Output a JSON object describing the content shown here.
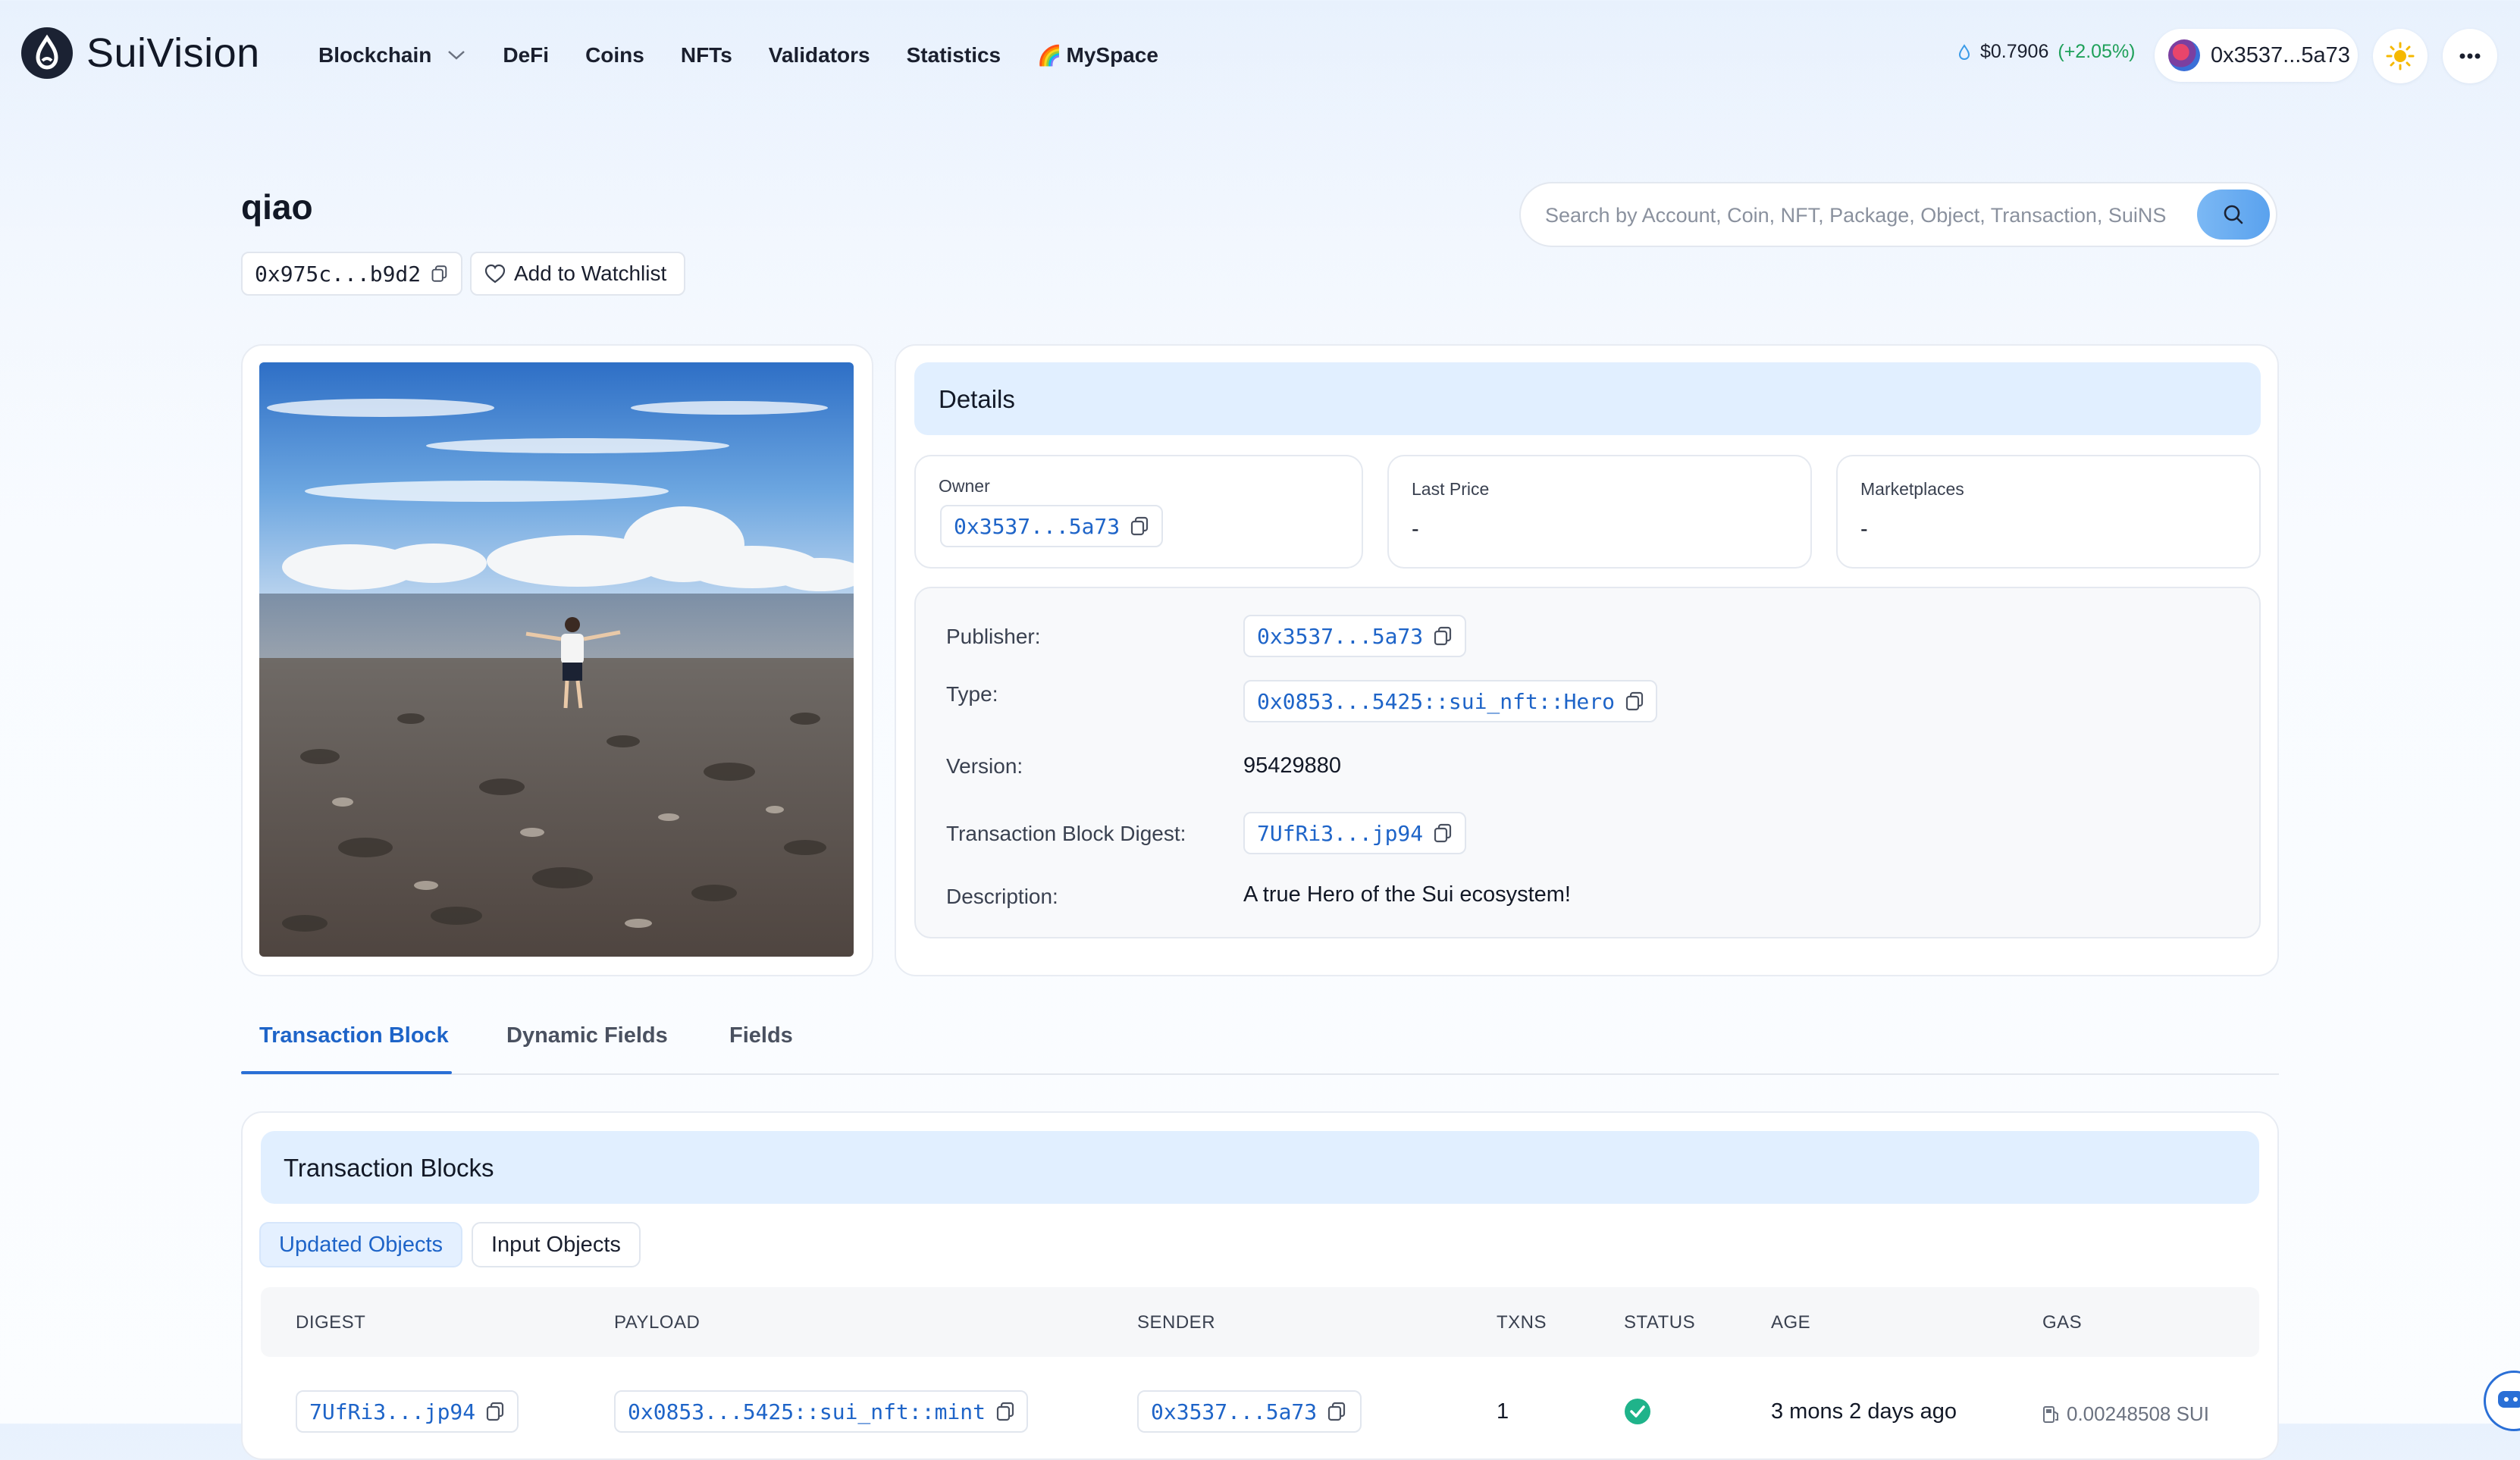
{
  "nav": {
    "logo_text": "SuiVision",
    "menu": [
      "Blockchain",
      "DeFi",
      "Coins",
      "NFTs",
      "Validators",
      "Statistics",
      "MySpace"
    ],
    "myspace_emoji": "🌈",
    "sui_price": "$0.7906",
    "sui_change": "(+2.05%)",
    "wallet_address": "0x3537...5a73"
  },
  "header": {
    "title": "qiao",
    "object_id": "0x975c...b9d2",
    "watchlist_label": "Add to Watchlist",
    "search_placeholder": "Search by Account, Coin, NFT, Package, Object, Transaction, SuiNS"
  },
  "details": {
    "title": "Details",
    "owner_label": "Owner",
    "owner_value": "0x3537...5a73",
    "last_price_label": "Last Price",
    "last_price_value": "-",
    "marketplaces_label": "Marketplaces",
    "marketplaces_value": "-",
    "publisher_label": "Publisher:",
    "publisher_value": "0x3537...5a73",
    "type_label": "Type:",
    "type_value": "0x0853...5425::sui_nft::Hero",
    "version_label": "Version:",
    "version_value": "95429880",
    "digest_label": "Transaction Block Digest:",
    "digest_value": "7UfRi3...jp94",
    "description_label": "Description:",
    "description_value": "A true Hero of the Sui ecosystem!"
  },
  "tabs": [
    "Transaction Block",
    "Dynamic Fields",
    "Fields"
  ],
  "transactions": {
    "title": "Transaction Blocks",
    "filters": [
      "Updated Objects",
      "Input Objects"
    ],
    "columns": [
      "DIGEST",
      "PAYLOAD",
      "SENDER",
      "TXNS",
      "STATUS",
      "AGE",
      "GAS"
    ],
    "rows": [
      {
        "digest": "7UfRi3...jp94",
        "payload": "0x0853...5425::sui_nft::mint",
        "sender": "0x3537...5a73",
        "txns": "1",
        "status": "success",
        "age": "3 mons 2 days ago",
        "gas": "0.00248508 SUI"
      }
    ]
  },
  "colors": {
    "accent": "#1e64c8",
    "success": "#1fb38a",
    "price_up": "#1fa05a",
    "band": "#e1efff"
  }
}
